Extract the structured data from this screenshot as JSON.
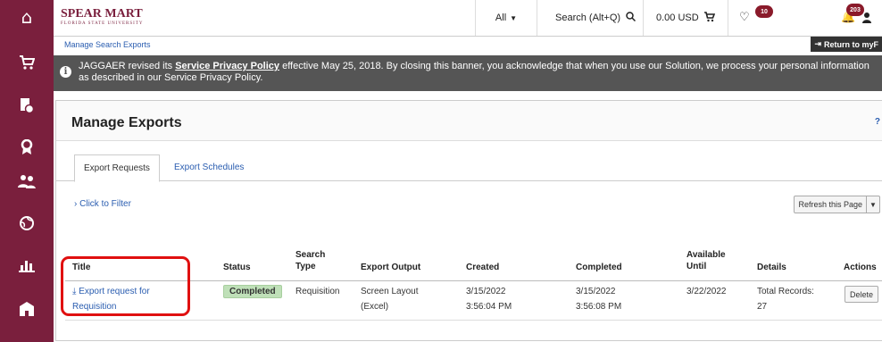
{
  "topbar": {
    "logo_text": "SPEAR MART",
    "logo_subtext": "FLORIDA STATE UNIVERSITY",
    "scope_select": "All",
    "search_placeholder": "Search (Alt+Q)",
    "cart_amount": "0.00 USD",
    "favorites_count": "10",
    "notifications_count": "203"
  },
  "breadcrumb": "Manage Search Exports",
  "return_label": "Return to myF",
  "banner": {
    "text_before": "JAGGAER revised its",
    "link_text": "Service Privacy Policy",
    "text_after": "effective May 25, 2018. By closing this banner, you acknowledge that when you use our Solution, we process your personal information as described in our Service Privacy Policy."
  },
  "page": {
    "title": "Manage Exports",
    "help": "?",
    "tabs": [
      "Export Requests",
      "Export Schedules"
    ],
    "filter_label": "Click to Filter",
    "refresh_label": "Refresh this Page"
  },
  "table": {
    "headers": {
      "title": "Title",
      "status": "Status",
      "search_type": "Search Type",
      "export_output": "Export Output",
      "created": "Created",
      "completed": "Completed",
      "available_until": "Available Until",
      "details": "Details",
      "actions": "Actions"
    },
    "row": {
      "title": "Export request for Requisition",
      "status": "Completed",
      "search_type": "Requisition",
      "export_output": "Screen Layout (Excel)",
      "created": "3/15/2022 3:56:04 PM",
      "completed": "3/15/2022 3:56:08 PM",
      "available_until": "3/22/2022",
      "details": "Total Records: 27",
      "action": "Delete"
    }
  },
  "icons": {
    "sidebar": [
      "home-icon",
      "cart-icon",
      "orders-icon",
      "award-icon",
      "people-icon",
      "globe-icon",
      "chart-icon",
      "building-icon"
    ]
  },
  "colors": {
    "sidebar": "#7a1f3d",
    "link": "#2a5db0",
    "status_completed": "#bfe0b8",
    "highlight": "#e01010"
  }
}
